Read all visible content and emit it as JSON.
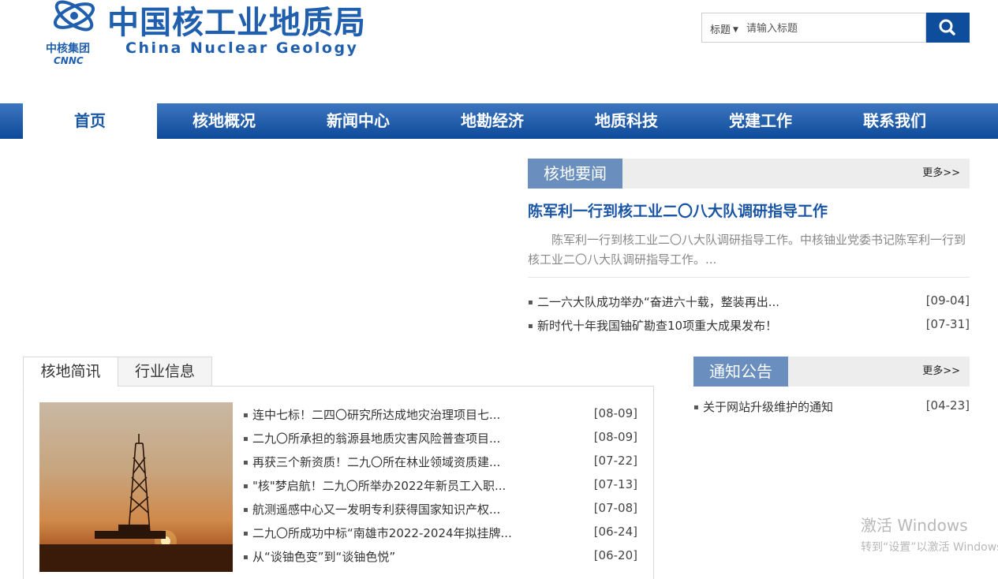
{
  "header": {
    "logo_cn": "中国核工业地质局",
    "logo_en": "China Nuclear Geology",
    "logo_sub_cn": "中核集团",
    "logo_sub_en": "CNNC",
    "brand_color": "#1f5fae"
  },
  "search": {
    "field_label": "标题",
    "placeholder": "请输入标题",
    "button_icon": "search-icon",
    "button_color": "#0e4d9c"
  },
  "nav": {
    "items": [
      {
        "label": "首页",
        "active": true
      },
      {
        "label": "核地概况",
        "active": false
      },
      {
        "label": "新闻中心",
        "active": false
      },
      {
        "label": "地勘经济",
        "active": false
      },
      {
        "label": "地质科技",
        "active": false
      },
      {
        "label": "党建工作",
        "active": false
      },
      {
        "label": "联系我们",
        "active": false
      }
    ]
  },
  "key_news": {
    "title": "核地要闻",
    "more": "更多>>",
    "headline": "陈军利一行到核工业二〇八大队调研指导工作",
    "summary": "陈军利一行到核工业二〇八大队调研指导工作。中核铀业党委书记陈军利一行到核工业二〇八大队调研指导工作。...",
    "items": [
      {
        "title": "二一六大队成功举办“奋进六十载，整装再出...",
        "date": "[09-04]"
      },
      {
        "title": "新时代十年我国铀矿勘查10项重大成果发布！",
        "date": "[07-31]"
      }
    ]
  },
  "tabs": {
    "items": [
      {
        "label": "核地简讯",
        "active": true
      },
      {
        "label": "行业信息",
        "active": false
      }
    ],
    "list": [
      {
        "title": "连中七标！二四〇研究所达成地灾治理项目七...",
        "date": "[08-09]"
      },
      {
        "title": "二九〇所承担的翁源县地质灾害风险普查项目...",
        "date": "[08-09]"
      },
      {
        "title": "再获三个新资质！二九〇所在林业领域资质建...",
        "date": "[07-22]"
      },
      {
        "title": "\"核\"梦启航！二九〇所举办2022年新员工入职...",
        "date": "[07-13]"
      },
      {
        "title": "航测遥感中心又一发明专利获得国家知识产权...",
        "date": "[07-08]"
      },
      {
        "title": "二九〇所成功中标“南雄市2022-2024年拟挂牌...",
        "date": "[06-24]"
      },
      {
        "title": "从“谈铀色变”到“谈铀色悦”",
        "date": "[06-20]"
      }
    ]
  },
  "notice": {
    "title": "通知公告",
    "more": "更多>>",
    "items": [
      {
        "title": "关于网站升级维护的通知",
        "date": "[04-23]"
      }
    ]
  },
  "watermark": {
    "line1": "激活 Windows",
    "line2": "转到“设置”以激活 Windows。"
  }
}
